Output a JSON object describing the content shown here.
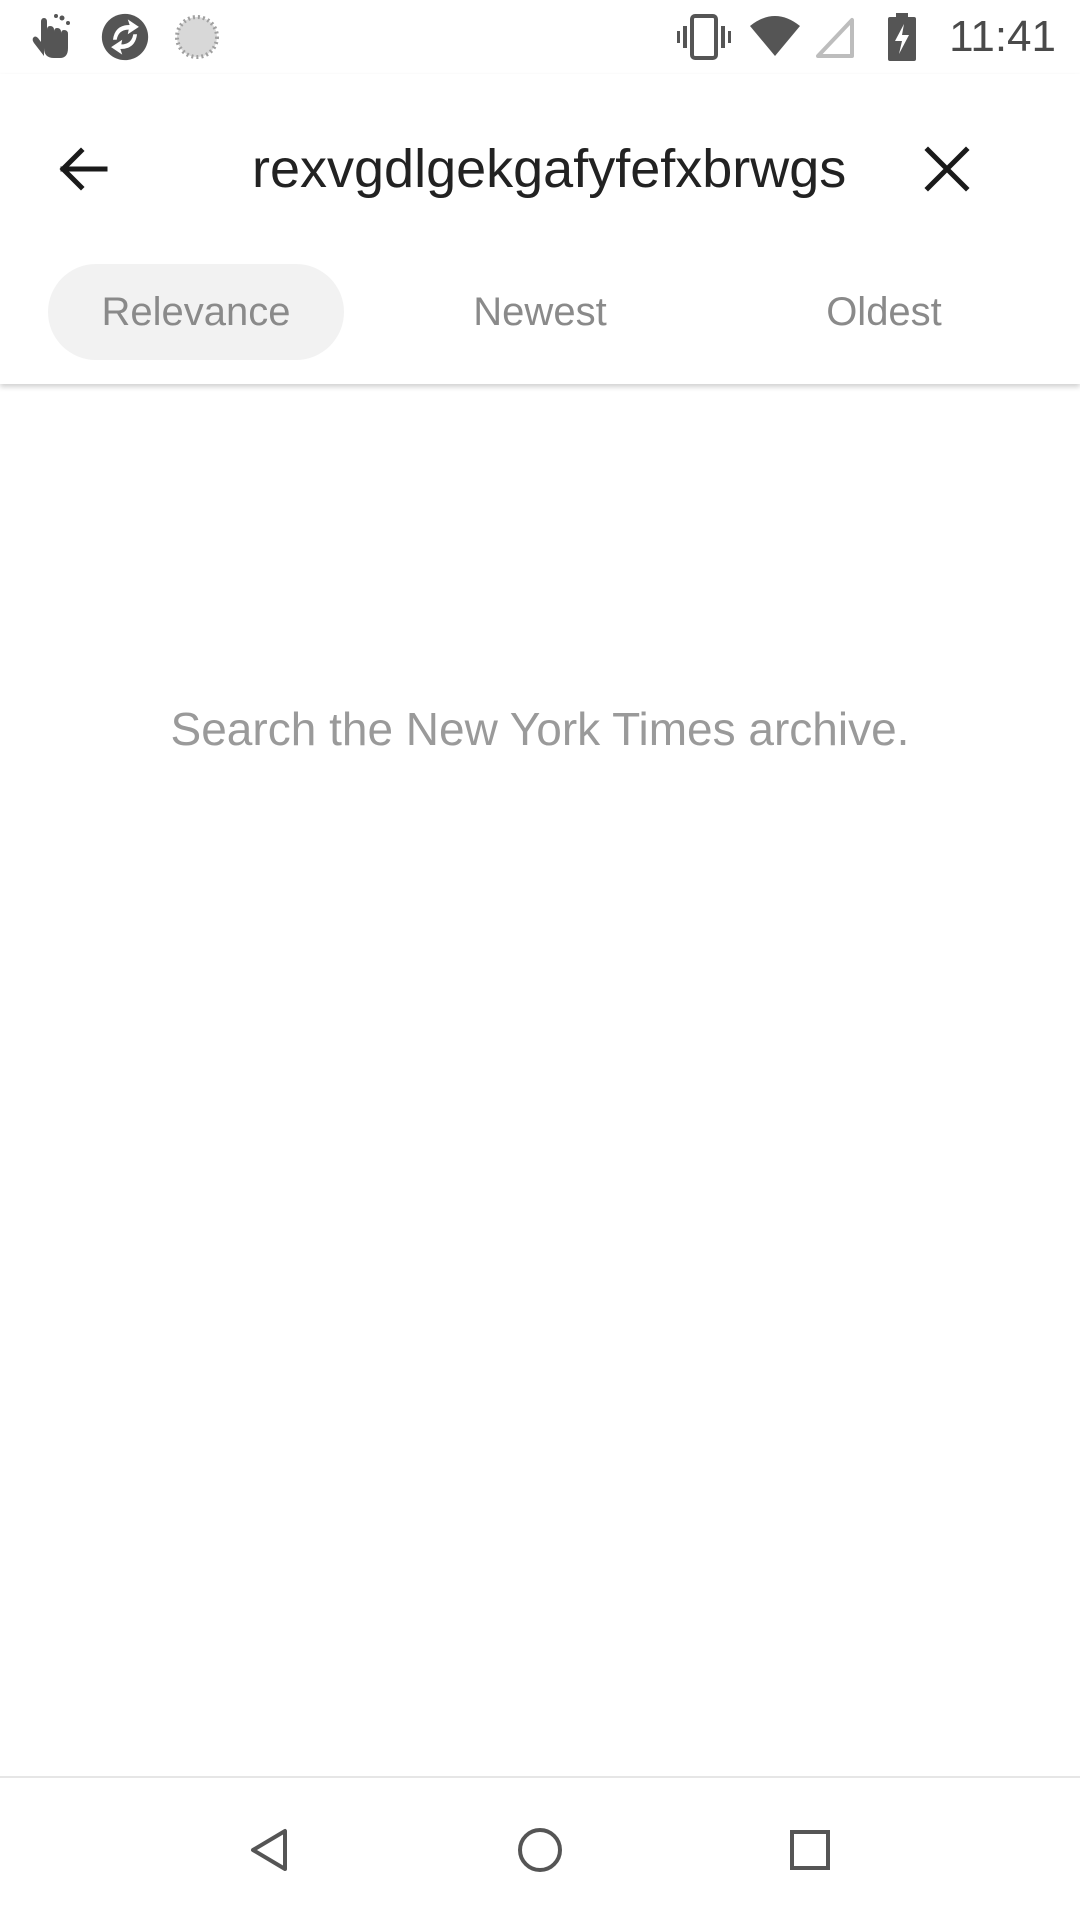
{
  "status_bar": {
    "time": "11:41",
    "left_icons": [
      "hand-notification-icon",
      "app-sync-icon",
      "loading-icon"
    ],
    "right_icons": [
      "vibrate-icon",
      "wifi-icon",
      "signal-icon",
      "battery-charging-icon"
    ]
  },
  "search": {
    "query": "rexvgdlgekgafyfefxbrwgs",
    "back_icon": "arrow-left-icon",
    "clear_icon": "close-icon"
  },
  "sort_tabs": [
    {
      "label": "Relevance",
      "active": true
    },
    {
      "label": "Newest",
      "active": false
    },
    {
      "label": "Oldest",
      "active": false
    }
  ],
  "empty_state": {
    "message": "Search the New York Times archive."
  },
  "nav_bar": {
    "icons": [
      "nav-back-icon",
      "nav-home-icon",
      "nav-recents-icon"
    ]
  },
  "colors": {
    "background": "#ffffff",
    "text_primary": "#222222",
    "text_secondary": "#8a8a8a",
    "active_tab_bg": "#f2f2f2"
  }
}
